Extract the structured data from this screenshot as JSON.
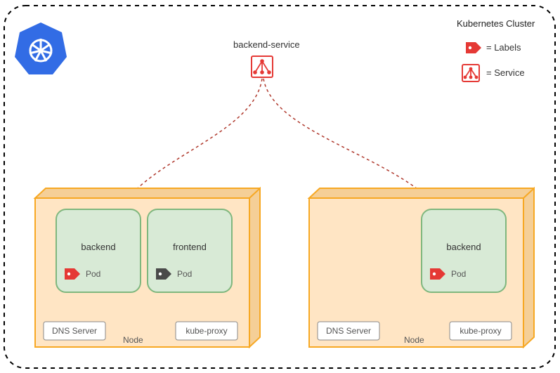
{
  "cluster": {
    "title": "Kubernetes Cluster"
  },
  "service": {
    "label": "backend-service"
  },
  "legend": {
    "labels": "= Labels",
    "service": "= Service"
  },
  "nodes": [
    {
      "label": "Node",
      "dns": "DNS Server",
      "proxy": "kube-proxy",
      "pods": [
        {
          "name": "backend",
          "caption": "Pod",
          "tagColor": "#e53935"
        },
        {
          "name": "frontend",
          "caption": "Pod",
          "tagColor": "#4a4a4a"
        }
      ]
    },
    {
      "label": "Node",
      "dns": "DNS Server",
      "proxy": "kube-proxy",
      "pods": [
        {
          "name": "backend",
          "caption": "Pod",
          "tagColor": "#e53935"
        }
      ]
    }
  ],
  "icons": {
    "k8s": "kubernetes-logo-icon",
    "tag": "label-tag-icon",
    "svc": "service-icon"
  }
}
